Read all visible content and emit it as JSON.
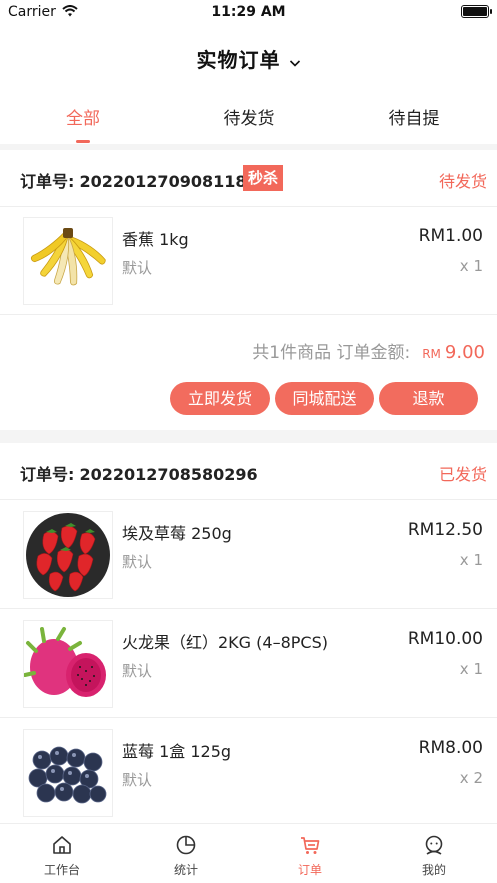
{
  "status_bar": {
    "carrier": "Carrier",
    "time": "11:29 AM"
  },
  "header": {
    "title": "实物订单",
    "dropdown_icon": "chevron-down-icon"
  },
  "tabs": [
    {
      "label": "全部",
      "active": true
    },
    {
      "label": "待发货",
      "active": false
    },
    {
      "label": "待自提",
      "active": false
    }
  ],
  "orders": [
    {
      "order_no_label": "订单号:",
      "order_no": "2022012709081187",
      "badge": "秒杀",
      "status": "待发货",
      "items": [
        {
          "name": "香蕉 1kg",
          "spec": "默认",
          "price": "RM1.00",
          "qty": "x 1",
          "image": "banana"
        }
      ],
      "summary": {
        "text": "共1件商品 订单金额:",
        "currency": "RM",
        "amount": "9.00"
      },
      "actions": [
        "立即发货",
        "同城配送",
        "退款"
      ]
    },
    {
      "order_no_label": "订单号:",
      "order_no": "2022012708580296",
      "status": "已发货",
      "items": [
        {
          "name": "埃及草莓 250g",
          "spec": "默认",
          "price": "RM12.50",
          "qty": "x 1",
          "image": "strawberry"
        },
        {
          "name": "火龙果（红）2KG (4–8PCS)",
          "spec": "默认",
          "price": "RM10.00",
          "qty": "x 1",
          "image": "dragon-fruit"
        },
        {
          "name": "蓝莓 1盒 125g",
          "spec": "默认",
          "price": "RM8.00",
          "qty": "x 2",
          "image": "blueberry"
        }
      ]
    }
  ],
  "tabbar": [
    {
      "label": "工作台",
      "icon": "home-icon",
      "active": false
    },
    {
      "label": "统计",
      "icon": "pie-chart-icon",
      "active": false
    },
    {
      "label": "订单",
      "icon": "cart-icon",
      "active": true
    },
    {
      "label": "我的",
      "icon": "profile-icon",
      "active": false
    }
  ],
  "colors": {
    "accent": "#f2685a",
    "muted_text": "#999999",
    "background": "#f4f4f4"
  }
}
